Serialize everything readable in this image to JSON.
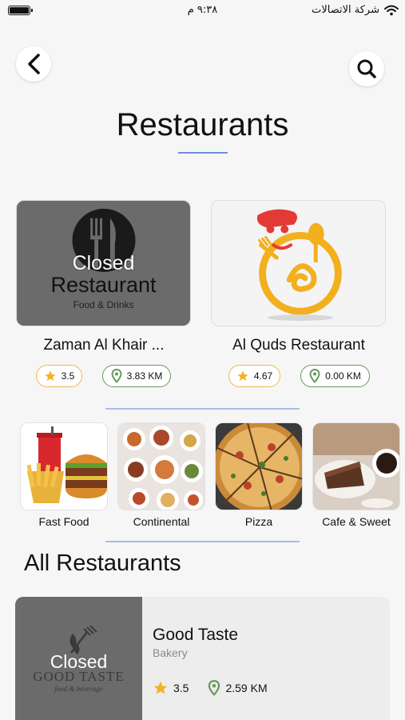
{
  "status_bar": {
    "time": "٩:٣٨ م",
    "carrier": "شركة الاتصالات"
  },
  "header": {
    "title": "Restaurants"
  },
  "featured": [
    {
      "name": "Zaman Al Khair ...",
      "closed_label": "Closed",
      "logo_text": "Restaurant",
      "logo_subtext": "Food & Drinks",
      "rating": "3.5",
      "distance": "3.83 KM"
    },
    {
      "name": "Al Quds Restaurant",
      "rating": "4.67",
      "distance": "0.00 KM"
    }
  ],
  "categories": [
    {
      "label": "Fast Food",
      "icon": "fast-food-image"
    },
    {
      "label": "Continental",
      "icon": "continental-image"
    },
    {
      "label": "Pizza",
      "icon": "pizza-image"
    },
    {
      "label": "Cafe & Sweet",
      "icon": "cafe-image"
    }
  ],
  "all_restaurants": {
    "title": "All Restaurants",
    "items": [
      {
        "name": "Good Taste",
        "type": "Bakery",
        "closed_label": "Closed",
        "logo_text": "GOOD TASTE",
        "logo_subtext": "food & beverage",
        "rating": "3.5",
        "distance": "2.59 KM"
      }
    ]
  },
  "colors": {
    "accent_underline": "#6d8ce0",
    "star": "#f4b223",
    "rating_border": "#f0b84e",
    "distance_border": "#6a9a5c",
    "closed_overlay": "#6b6b6b"
  }
}
